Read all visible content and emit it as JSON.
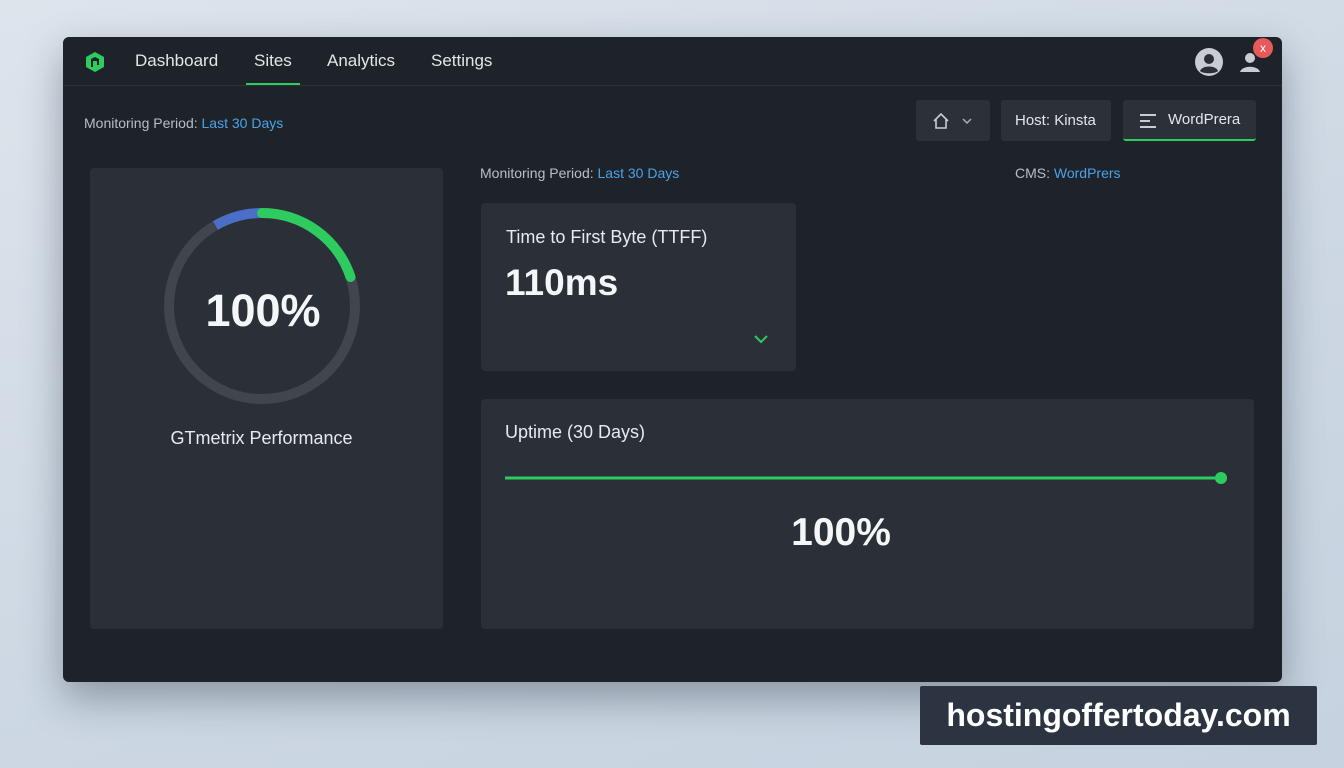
{
  "nav": {
    "tabs": [
      {
        "label": "Dashboard",
        "active": false
      },
      {
        "label": "Sites",
        "active": true
      },
      {
        "label": "Analytics",
        "active": false
      },
      {
        "label": "Settings",
        "active": false
      }
    ],
    "close_label": "x"
  },
  "header_period": {
    "label": "Monitoring Period:",
    "value": "Last 30 Days"
  },
  "toolbar": {
    "home_icon": "home-icon",
    "host_label": "Host:",
    "host_value": "Kinsta",
    "cms_button_label": "WordPrera"
  },
  "gtmetrix": {
    "score": "100%",
    "score_fraction": 1.0,
    "label": "GTmetrix Performance"
  },
  "sub_period": {
    "label": "Monitoring Period:",
    "value": "Last 30 Days"
  },
  "cms": {
    "label": "CMS:",
    "value": "WordPrers"
  },
  "ttfb": {
    "title": "Time to First Byte (TTFF)",
    "value": "110ms"
  },
  "uptime": {
    "title": "Uptime (30 Days)",
    "value": "100%",
    "fraction": 1.0
  },
  "watermark": "hostingoffertoday.com",
  "colors": {
    "accent": "#2ecc5f",
    "link": "#4aa3e8",
    "ring_blue": "#4a6fc8",
    "background": "#1e2229"
  }
}
